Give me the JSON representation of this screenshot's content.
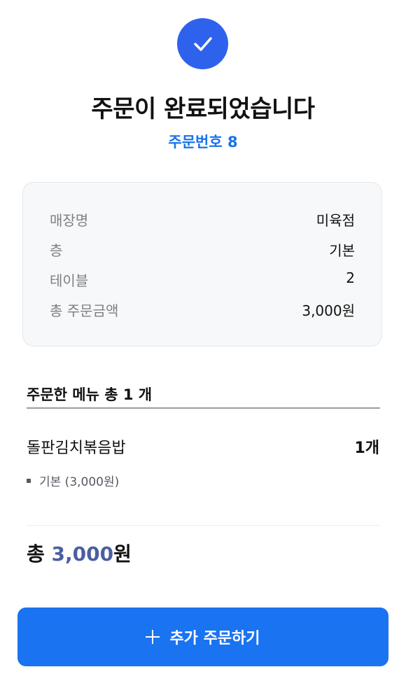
{
  "header": {
    "icon": "check-icon",
    "title": "주문이 완료되었습니다",
    "order_number": "주문번호 8"
  },
  "info": {
    "rows": [
      {
        "label": "매장명",
        "value": "미육점"
      },
      {
        "label": "층",
        "value": "기본"
      },
      {
        "label": "테이블",
        "value": "2"
      },
      {
        "label": "총 주문금액",
        "value": "3,000원"
      }
    ]
  },
  "menu": {
    "header": "주문한 메뉴 총 1 개",
    "items": [
      {
        "name": "돌판김치볶음밥",
        "quantity": "1개",
        "options": [
          "기본 (3,000원)"
        ]
      }
    ]
  },
  "total": {
    "label": "총",
    "amount": "3,000",
    "unit": "원"
  },
  "actions": {
    "add_order_label": "추가 주문하기",
    "add_order_icon": "plus-icon"
  },
  "colors": {
    "primary": "#1a73f0",
    "check_circle": "#2f62ec",
    "order_number": "#1a73e8",
    "total_amount": "#4a5fa0"
  }
}
